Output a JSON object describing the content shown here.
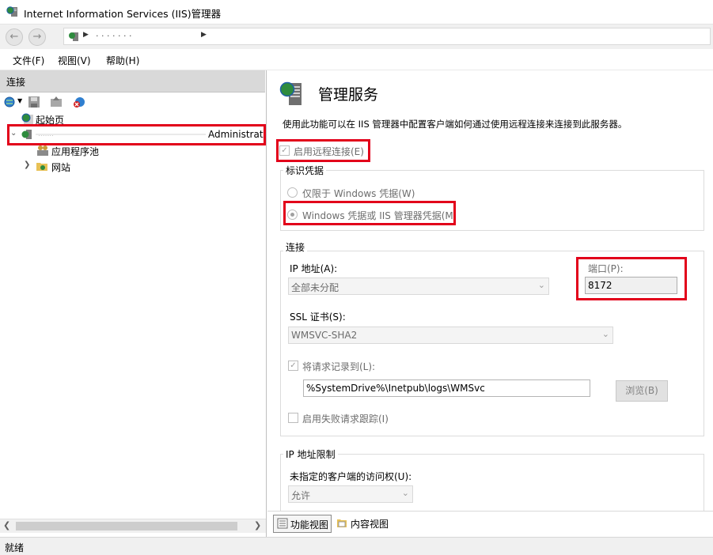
{
  "window": {
    "title": "Internet Information Services (IIS)管理器"
  },
  "address_bar": {
    "path_text": "· ·  ·  ·  ·  ·  ·"
  },
  "menu": [
    "文件(F)",
    "视图(V)",
    "帮助(H)"
  ],
  "connections": {
    "header": "连接",
    "tree": {
      "start_page": "起始页",
      "server_node": "Administrat",
      "app_pools": "应用程序池",
      "sites": "网站"
    }
  },
  "feature": {
    "title": "管理服务",
    "description": "使用此功能可以在 IIS 管理器中配置客户端如何通过使用远程连接来连接到此服务器。",
    "enable_remote": {
      "label": "启用远程连接(E)",
      "checked": true
    },
    "identity": {
      "group_label": "标识凭据",
      "options": [
        {
          "label": "仅限于 Windows 凭据(W)",
          "selected": false
        },
        {
          "label": "Windows 凭据或 IIS 管理器凭据(M",
          "selected": true
        }
      ]
    },
    "connection": {
      "group_label": "连接",
      "ip_label": "IP 地址(A):",
      "ip_value": "全部未分配",
      "port_label": "端口(P):",
      "port_value": "8172",
      "ssl_label": "SSL 证书(S):",
      "ssl_value": "WMSVC-SHA2",
      "log_label": "将请求记录到(L):",
      "log_checked": true,
      "log_path": "%SystemDrive%\\Inetpub\\logs\\WMSvc",
      "browse_button": "浏览(B)",
      "failed_trace_label": "启用失败请求跟踪(I)",
      "failed_trace_checked": false
    },
    "ip_restrictions": {
      "group_label": "IP 地址限制",
      "access_label": "未指定的客户端的访问权(U):",
      "access_value": "允许"
    }
  },
  "view_tabs": {
    "features_view": "功能视图",
    "content_view": "内容视图"
  },
  "status": "就绪",
  "colors": {
    "highlight_red": "#e2001a",
    "pane_header": "#d9d9d9"
  }
}
